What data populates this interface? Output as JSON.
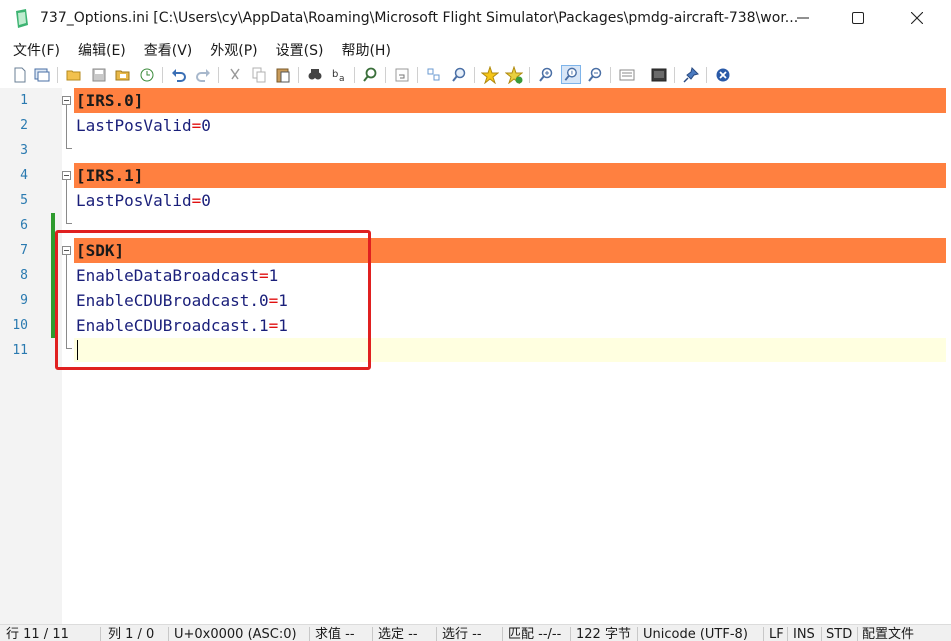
{
  "window": {
    "title": "737_Options.ini [C:\\Users\\cy\\AppData\\Roaming\\Microsoft Flight Simulator\\Packages\\pmdg-aircraft-738\\wor...",
    "icon": "notepad2-icon"
  },
  "menu": [
    {
      "label": "文件(F)"
    },
    {
      "label": "编辑(E)"
    },
    {
      "label": "查看(V)"
    },
    {
      "label": "外观(P)"
    },
    {
      "label": "设置(S)"
    },
    {
      "label": "帮助(H)"
    }
  ],
  "toolbar": {
    "icons": [
      "new-file-icon",
      "new-window-icon",
      "open-folder-icon",
      "save-icon",
      "browse-icon",
      "recent-icon",
      "undo-icon",
      "redo-icon",
      "cut-icon",
      "copy-icon",
      "paste-icon",
      "find-icon",
      "replace-icon",
      "goto-icon",
      "wordwrap-icon",
      "split-icon",
      "zoom-view-icon",
      "favorites-icon",
      "add-favorite-icon",
      "zoom-in-icon",
      "zoom-reset-icon",
      "zoom-out-icon",
      "schemes-icon",
      "scheme-config-icon",
      "pin-icon",
      "close-doc-icon"
    ]
  },
  "editor": {
    "lines": [
      {
        "num": "1",
        "section": "[IRS.0]"
      },
      {
        "num": "2",
        "key": "LastPosValid",
        "eq": "=",
        "value": "0"
      },
      {
        "num": "3"
      },
      {
        "num": "4",
        "section": "[IRS.1]"
      },
      {
        "num": "5",
        "key": "LastPosValid",
        "eq": "=",
        "value": "0"
      },
      {
        "num": "6"
      },
      {
        "num": "7",
        "section": "[SDK]"
      },
      {
        "num": "8",
        "key": "EnableDataBroadcast",
        "eq": "=",
        "value": "1"
      },
      {
        "num": "9",
        "key": "EnableCDUBroadcast.0",
        "eq": "=",
        "value": "1"
      },
      {
        "num": "10",
        "key": "EnableCDUBroadcast.1",
        "eq": "=",
        "value": "1"
      },
      {
        "num": "11"
      }
    ],
    "section_color": "#ff8040",
    "current_line_color": "#ffffe0",
    "highlight_color": "#e02020"
  },
  "status": {
    "line": "行 11 / 11",
    "col": "列 1 / 0",
    "char": "U+0x0000 (ASC:0)",
    "sum": "求值 --",
    "sel": "选定 --",
    "sel_lines": "选行 --",
    "match": "匹配 --/--",
    "size": "122 字节",
    "encoding": "Unicode (UTF-8)",
    "eol": "LF",
    "ovr": "INS",
    "mode": "STD",
    "scheme": "配置文件"
  }
}
